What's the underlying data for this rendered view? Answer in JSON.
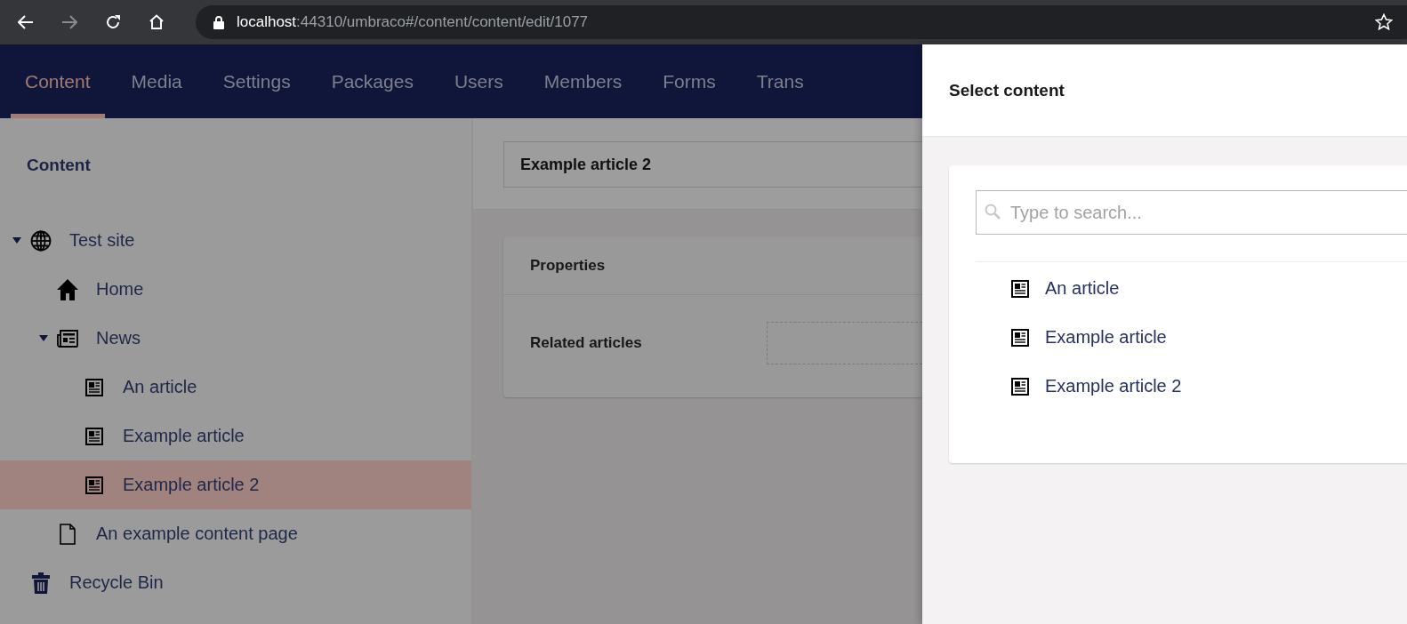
{
  "browser": {
    "url_host": "localhost",
    "url_path": ":44310/umbraco#/content/content/edit/1077"
  },
  "nav": {
    "tabs": [
      {
        "label": "Content",
        "selected": true
      },
      {
        "label": "Media",
        "selected": false
      },
      {
        "label": "Settings",
        "selected": false
      },
      {
        "label": "Packages",
        "selected": false
      },
      {
        "label": "Users",
        "selected": false
      },
      {
        "label": "Members",
        "selected": false
      },
      {
        "label": "Forms",
        "selected": false
      },
      {
        "label": "Trans",
        "selected": false
      }
    ]
  },
  "tree": {
    "title": "Content",
    "items": [
      {
        "label": "Test site",
        "kind": "globe",
        "expanded": true,
        "selected": false,
        "children": [
          {
            "label": "Home",
            "kind": "home",
            "selected": false
          },
          {
            "label": "News",
            "kind": "news",
            "expanded": true,
            "selected": false,
            "children": [
              {
                "label": "An article",
                "kind": "article",
                "selected": false
              },
              {
                "label": "Example article",
                "kind": "article",
                "selected": false
              },
              {
                "label": "Example article 2",
                "kind": "article",
                "selected": true
              }
            ]
          },
          {
            "label": "An example content page",
            "kind": "page",
            "selected": false
          }
        ]
      },
      {
        "label": "Recycle Bin",
        "kind": "trash",
        "selected": false
      }
    ]
  },
  "editor": {
    "name_value": "Example article 2",
    "group_title": "Properties",
    "properties": [
      {
        "label": "Related articles"
      }
    ]
  },
  "panel": {
    "title": "Select content",
    "search": {
      "placeholder": "Type to search..."
    },
    "items": [
      {
        "label": "An article",
        "kind": "article"
      },
      {
        "label": "Example article",
        "kind": "article"
      },
      {
        "label": "Example article 2",
        "kind": "article"
      }
    ]
  }
}
